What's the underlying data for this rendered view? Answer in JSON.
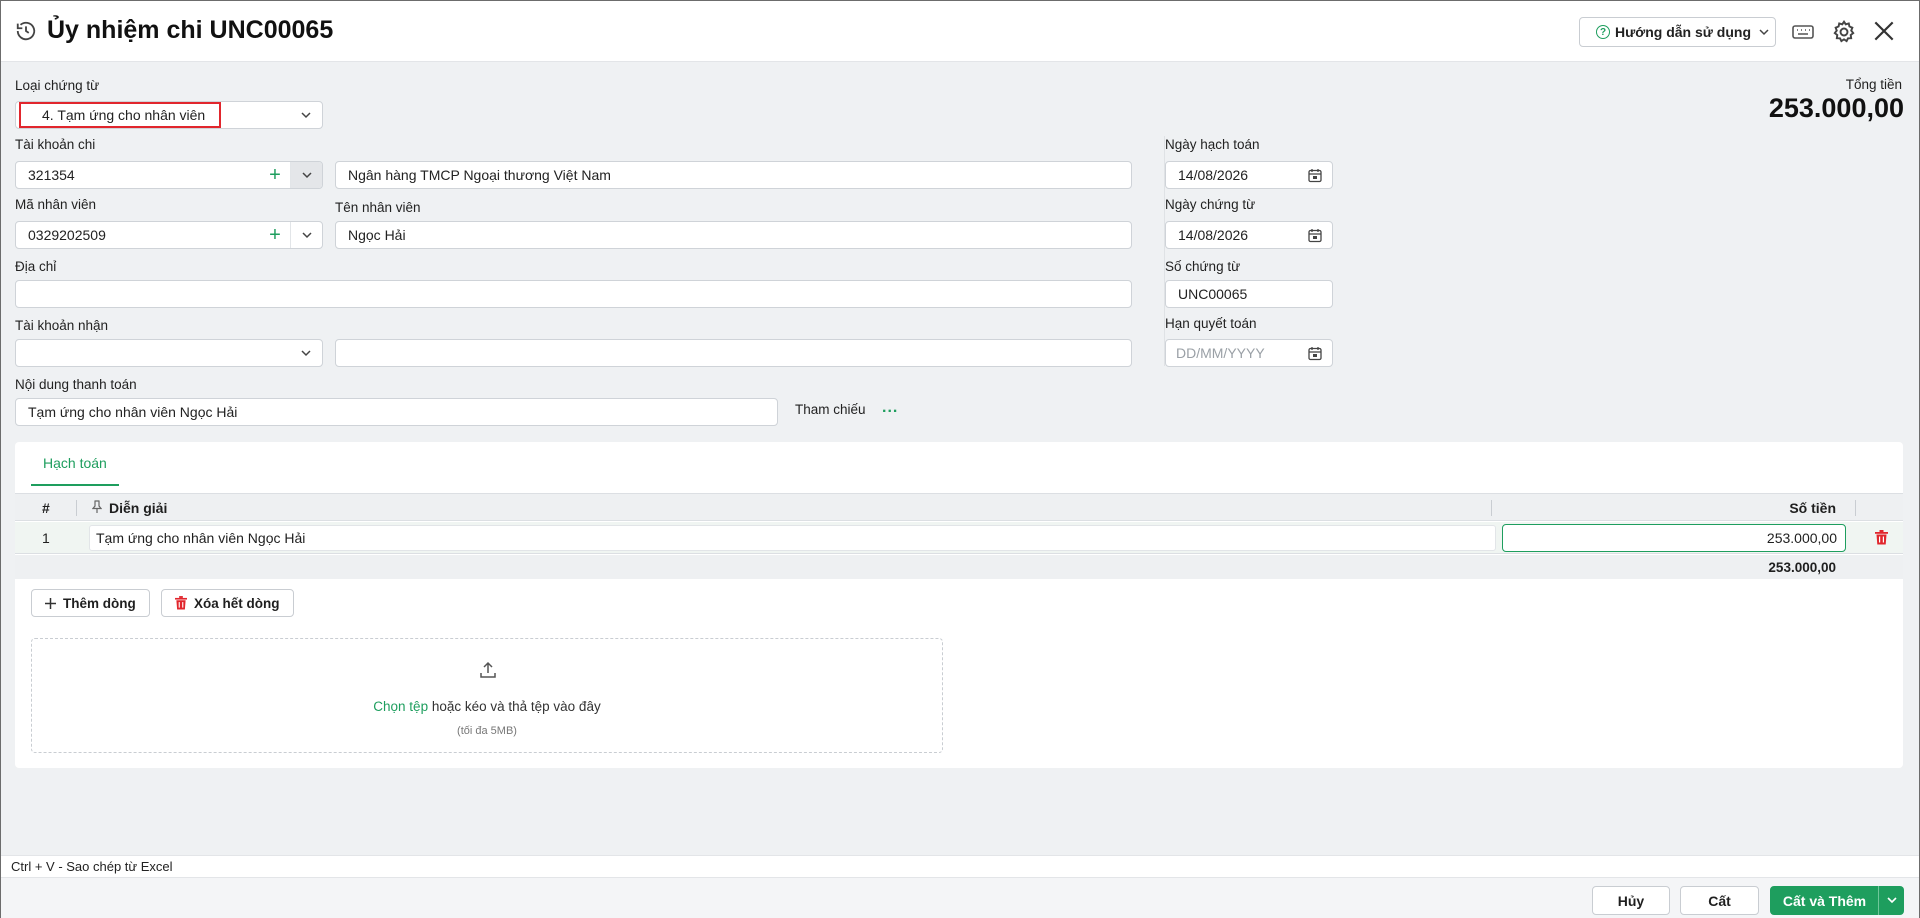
{
  "header": {
    "title": "Ủy nhiệm chi UNC00065",
    "help_label": "Hướng dẫn sử dụng"
  },
  "form": {
    "voucher_type": {
      "label": "Loại chứng từ",
      "value": "4. Tạm ứng cho nhân viên"
    },
    "total": {
      "label": "Tổng tiền",
      "value": "253.000,00"
    },
    "pay_account": {
      "label": "Tài khoản chi",
      "value": "321354",
      "bank_name": "Ngân hàng TMCP Ngoại thương Việt Nam"
    },
    "employee_code": {
      "label": "Mã nhân viên",
      "value": "0329202509"
    },
    "employee_name": {
      "label": "Tên nhân viên",
      "value": "Ngọc Hải"
    },
    "address": {
      "label": "Địa chỉ",
      "value": ""
    },
    "receive_account": {
      "label": "Tài khoản nhận",
      "value": "",
      "bank_name": ""
    },
    "payment_content": {
      "label": "Nội dung thanh toán",
      "value": "Tạm ứng cho nhân viên Ngọc Hải"
    },
    "reference": {
      "label": "Tham chiếu",
      "more": "..."
    },
    "posting_date": {
      "label": "Ngày hạch toán",
      "value": "14/08/2026"
    },
    "voucher_date": {
      "label": "Ngày chứng từ",
      "value": "14/08/2026"
    },
    "voucher_no": {
      "label": "Số chứng từ",
      "value": "UNC00065"
    },
    "settlement_deadline": {
      "label": "Hạn quyết toán",
      "placeholder": "DD/MM/YYYY"
    }
  },
  "detail": {
    "tab": "Hạch toán",
    "columns": {
      "num": "#",
      "desc": "Diễn giải",
      "amount": "Số tiền"
    },
    "rows": [
      {
        "num": "1",
        "desc": "Tạm ứng cho nhân viên Ngọc Hải",
        "amount": "253.000,00"
      }
    ],
    "sum": "253.000,00",
    "add_row": "Thêm dòng",
    "clear_rows": "Xóa hết dòng",
    "upload": {
      "link": "Chọn tệp",
      "text": " hoặc kéo và thả tệp vào đây",
      "hint": "(tối đa 5MB)"
    }
  },
  "footer": {
    "hint": "Ctrl + V - Sao chép từ Excel",
    "cancel": "Hủy",
    "save": "Cất",
    "save_add": "Cất và Thêm"
  },
  "colors": {
    "accent": "#1e9e5e",
    "highlight": "#e1262d",
    "delete": "#e1262d"
  }
}
